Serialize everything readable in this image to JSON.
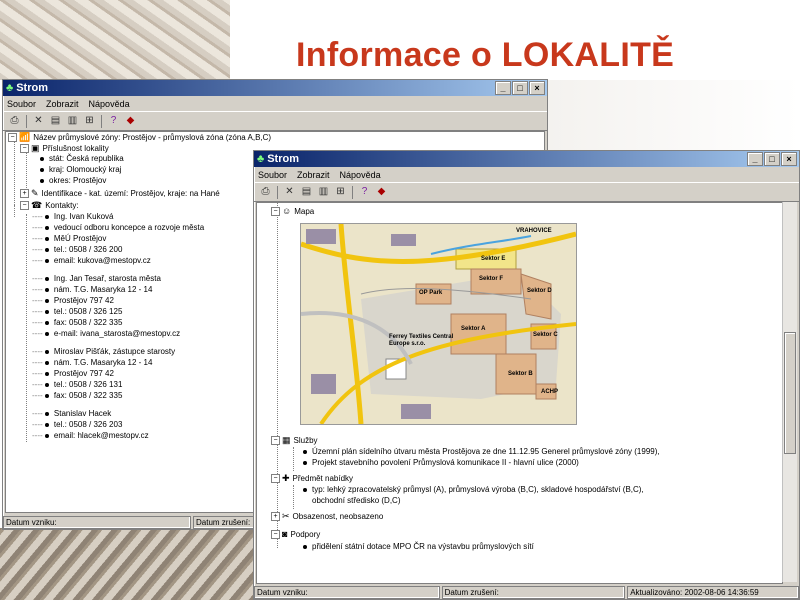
{
  "slide_title": "Informace o LOKALITĚ",
  "back_window": {
    "title": "Strom",
    "menu": [
      "Soubor",
      "Zobrazit",
      "Nápověda"
    ],
    "tree": {
      "root": "Název průmyslové zóny: Prostějov - průmyslová zóna (zóna A,B,C)",
      "prislusnost": {
        "label": "Příslušnost lokality",
        "items": [
          "stát:    Česká republika",
          "kraj:    Olomoucký kraj",
          "okres:  Prostějov"
        ]
      },
      "identifikace": "Identifikace - kat. území: Prostějov, kraje: na Hané",
      "kontakty": {
        "label": "Kontakty:",
        "items": [
          "Ing. Ivan Kuková",
          "vedoucí odboru koncepce a rozvoje města",
          "MěÚ Prostějov",
          "tel.: 0508 / 326 200",
          "email: kukova@mestopv.cz",
          "Ing. Jan Tesař, starosta města",
          "nám. T.G. Masaryka 12 - 14",
          "Prostějov 797 42",
          "tel.: 0508 / 326 125",
          "fax: 0508 / 322 335",
          "e-mail: ivana_starosta@mestopv.cz",
          "Miroslav Pišťák, zástupce starosty",
          "nám. T.G. Masaryka 12 - 14",
          "Prostějov 797 42",
          "tel.: 0508 / 326 131",
          "fax: 0508 / 322 335",
          "Stanislav Hacek",
          "tel.: 0508 / 326 203",
          "email: hlacek@mestopv.cz"
        ]
      }
    },
    "status": [
      "Datum vzniku:",
      "Datum zrušení:"
    ]
  },
  "front_window": {
    "title": "Strom",
    "menu": [
      "Soubor",
      "Zobrazit",
      "Nápověda"
    ],
    "tree": {
      "mapa": "Mapa",
      "map_labels": {
        "town": "VRAHOVICE",
        "s_e": "Sektor E",
        "s_f": "Sektor F",
        "s_d": "Sektor D",
        "s_a": "Sektor A",
        "s_c": "Sektor C",
        "s_b": "Sektor B",
        "ferrey": "Ferrey Textiles Central Europe s.r.o.",
        "arch": "ACHP",
        "op": "OP Park"
      },
      "sluzby": {
        "label": "Služby",
        "items": [
          "Územní plán sídelního útvaru města Prostějova ze dne 11.12.95 Generel průmyslové zóny (1999),",
          "Projekt stavebního povolení Průmyslová komunikace II - hlavní ulice (2000)"
        ]
      },
      "predmet": {
        "label": "Předmět nabídky",
        "items": [
          "typ: lehký zpracovatelský průmysl (A), průmyslová výroba (B,C), skladové hospodářství (B,C),",
          "obchodní středisko (D,C)"
        ]
      },
      "obsazenost": "Obsazenost, neobsazeno",
      "podpory": {
        "label": "Podpory",
        "items": [
          "přidělení státní dotace MPO ČR na výstavbu průmyslových sítí"
        ]
      }
    },
    "status": [
      "Datum vzniku:",
      "Datum zrušení:",
      "Aktualizováno: 2002-08-06 14:36:59"
    ]
  },
  "window_buttons": [
    "_",
    "□",
    "×"
  ],
  "colors": {
    "title_red": "#c8381c",
    "titlebar": "#0a246a"
  }
}
